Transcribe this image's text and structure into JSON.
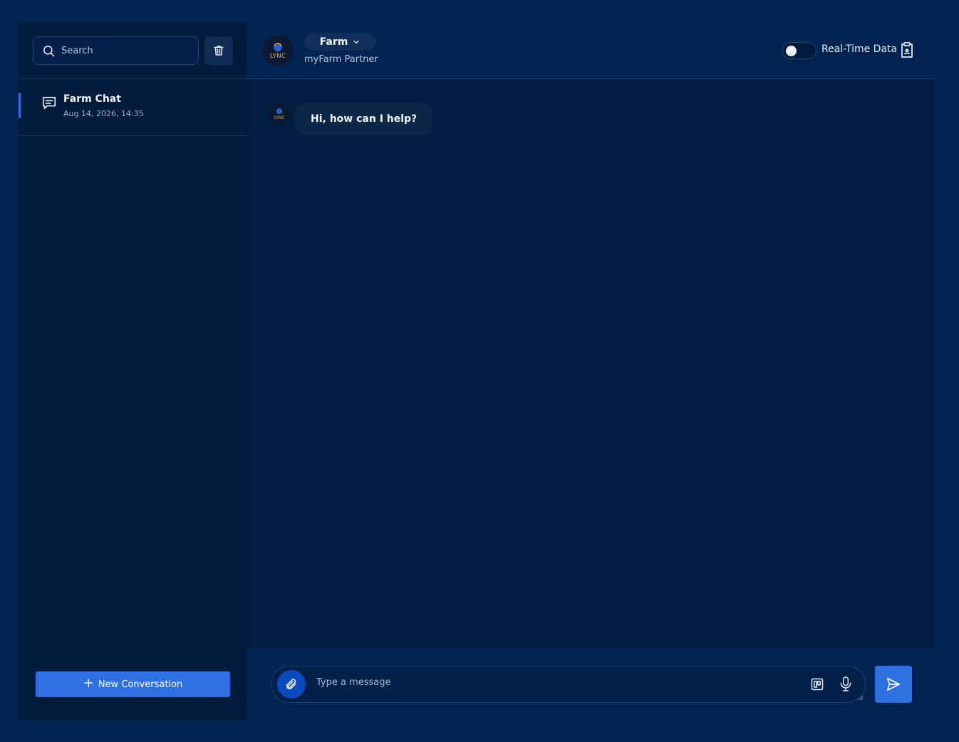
{
  "sidebar": {
    "search": {
      "placeholder": "Search"
    },
    "conversations": [
      {
        "title": "Farm Chat",
        "timestamp": "Aug 14, 2026, 14:35",
        "active": true
      }
    ],
    "new_conversation_label": "New Conversation"
  },
  "header": {
    "logo_text": "LYNC",
    "selector_label": "Farm",
    "subtitle": "myFarm Partner",
    "realtime_label": "Real-Time Data",
    "realtime_enabled": false
  },
  "messages": [
    {
      "sender": "assistant",
      "text": "Hi, how can I help?"
    }
  ],
  "composer": {
    "placeholder": "Type a message"
  },
  "colors": {
    "page_bg": "#012452",
    "panel_bg": "#011c3d",
    "chat_bg": "#011d3f",
    "accent": "#2f70e0",
    "logo_orange": "#f0a02a"
  }
}
